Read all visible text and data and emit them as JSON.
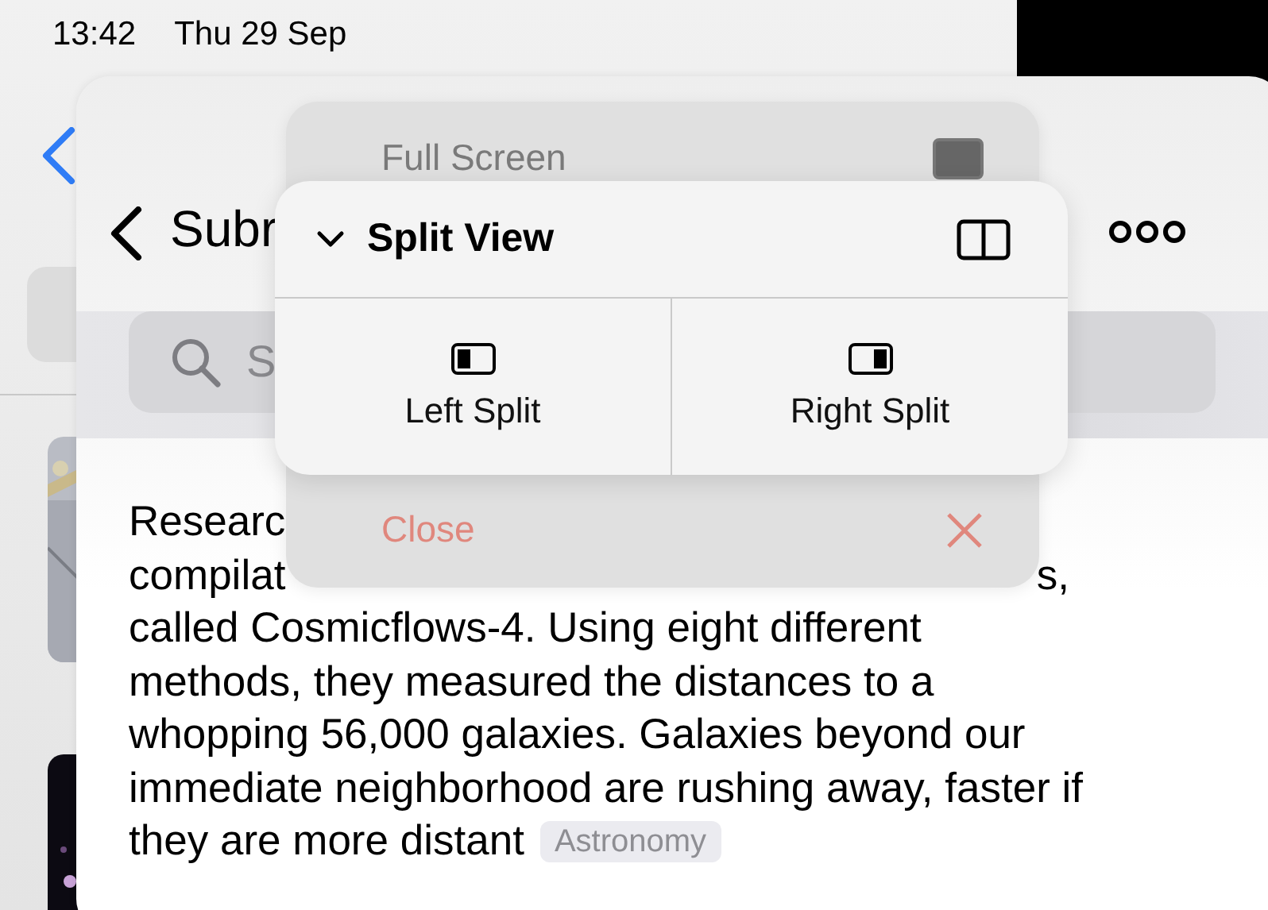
{
  "status_bar": {
    "time": "13:42",
    "date": "Thu 29 Sep"
  },
  "main_window": {
    "title": "Subr",
    "search": {
      "placeholder": "S"
    },
    "article": {
      "first_line_start": "Researc",
      "second_line_start": "compilat",
      "second_line_end": "s,",
      "lines": [
        "called Cosmicflows-4. Using eight different",
        "methods, they measured the distances to a",
        "whopping 56,000 galaxies. Galaxies beyond our",
        "immediate neighborhood are rushing away, faster if",
        "they are more distant"
      ],
      "tag": "Astronomy"
    }
  },
  "menu": {
    "items": [
      {
        "label": "Full Screen",
        "kind": "fullscreen"
      },
      {
        "label": "Close",
        "kind": "close"
      }
    ],
    "split_view": {
      "title": "Split View",
      "expanded": true,
      "options": [
        {
          "label": "Left Split",
          "kind": "left"
        },
        {
          "label": "Right Split",
          "kind": "right"
        }
      ]
    }
  }
}
